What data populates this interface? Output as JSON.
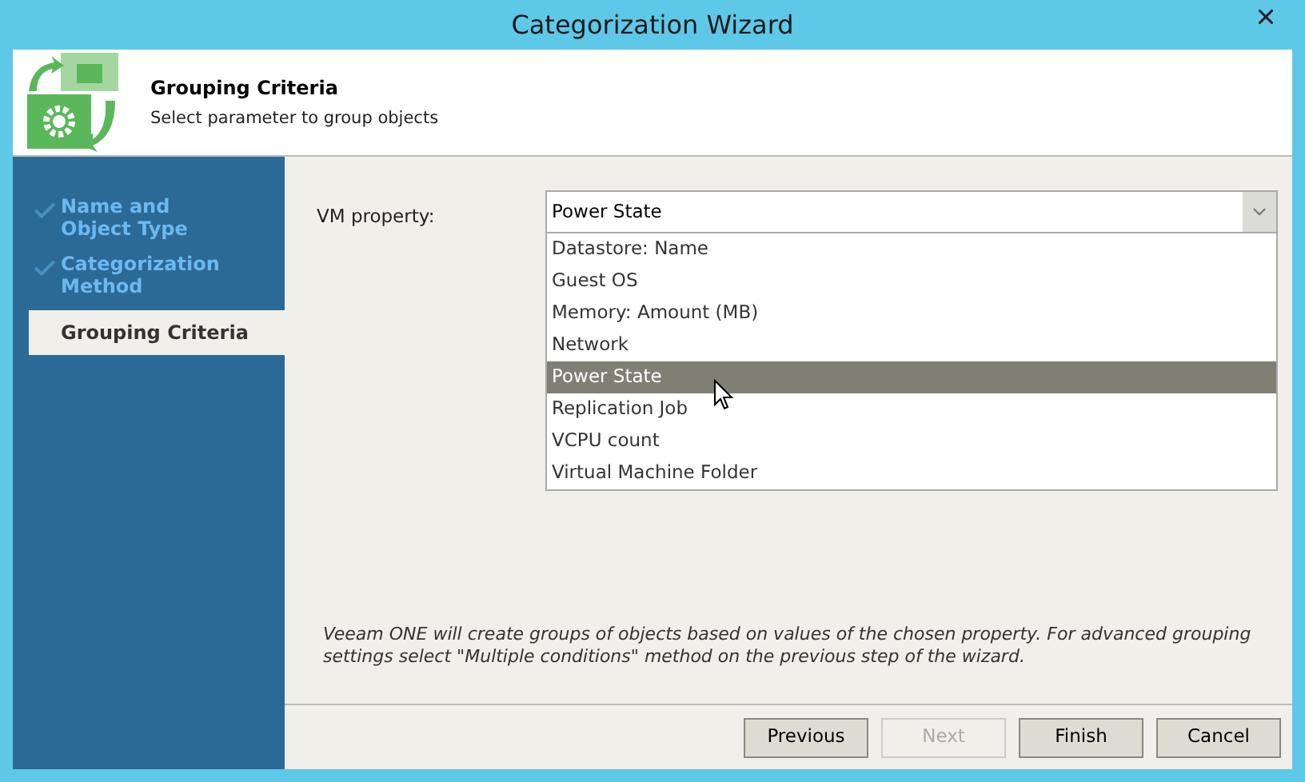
{
  "window": {
    "title": "Categorization Wizard"
  },
  "header": {
    "title": "Grouping Criteria",
    "subtitle": "Select parameter to group objects"
  },
  "steps": [
    {
      "label": "Name and Object Type",
      "completed": true,
      "selected": false
    },
    {
      "label": "Categorization Method",
      "completed": true,
      "selected": false
    },
    {
      "label": "Grouping Criteria",
      "completed": false,
      "selected": true
    }
  ],
  "vm_property": {
    "label": "VM property:",
    "value": "Power State",
    "expanded": true,
    "options": [
      {
        "label": "Datastore: Name",
        "selected": false
      },
      {
        "label": "Guest OS",
        "selected": false
      },
      {
        "label": "Memory: Amount (MB)",
        "selected": false
      },
      {
        "label": "Network",
        "selected": false
      },
      {
        "label": "Power State",
        "selected": true
      },
      {
        "label": "Replication Job",
        "selected": false
      },
      {
        "label": "VCPU count",
        "selected": false
      },
      {
        "label": "Virtual Machine Folder",
        "selected": false
      }
    ]
  },
  "note": "Veeam ONE will create groups of objects based on values of the chosen property. For advanced grouping settings select \"Multiple conditions\" method on the previous step of the wizard.",
  "buttons": [
    {
      "label": "Previous",
      "disabled": false
    },
    {
      "label": "Next",
      "disabled": true
    },
    {
      "label": "Finish",
      "disabled": false
    },
    {
      "label": "Cancel",
      "disabled": false
    }
  ]
}
